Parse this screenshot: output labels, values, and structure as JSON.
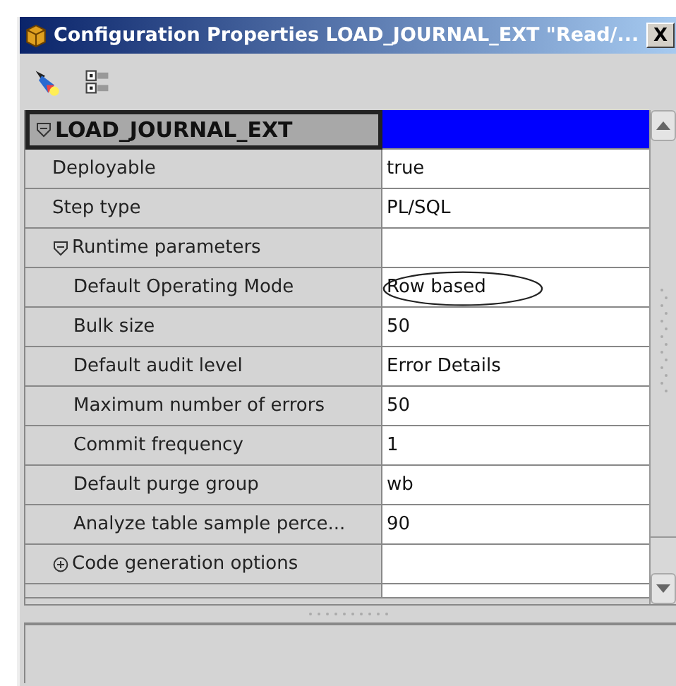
{
  "window": {
    "title": "Configuration Properties LOAD_JOURNAL_EXT \"Read/...",
    "close": "X"
  },
  "tree": {
    "label": "LOAD_JOURNAL_EXT",
    "expanded": true,
    "selected": true,
    "children": [
      {
        "label": "Deployable",
        "value": "true"
      },
      {
        "label": "Step type",
        "value": "PL/SQL"
      },
      {
        "label": "Runtime parameters",
        "expanded": true,
        "children": [
          {
            "label": "Default Operating Mode",
            "value": "Row based",
            "circled": true
          },
          {
            "label": "Bulk size",
            "value": "50"
          },
          {
            "label": "Default audit level",
            "value": "Error Details"
          },
          {
            "label": "Maximum number of errors",
            "value": "50"
          },
          {
            "label": "Commit frequency",
            "value": "1"
          },
          {
            "label": "Default purge group",
            "value": "wb"
          },
          {
            "label": "Analyze table sample perce...",
            "value": "90"
          }
        ]
      },
      {
        "label": "Code generation options",
        "expanded": false
      }
    ]
  }
}
